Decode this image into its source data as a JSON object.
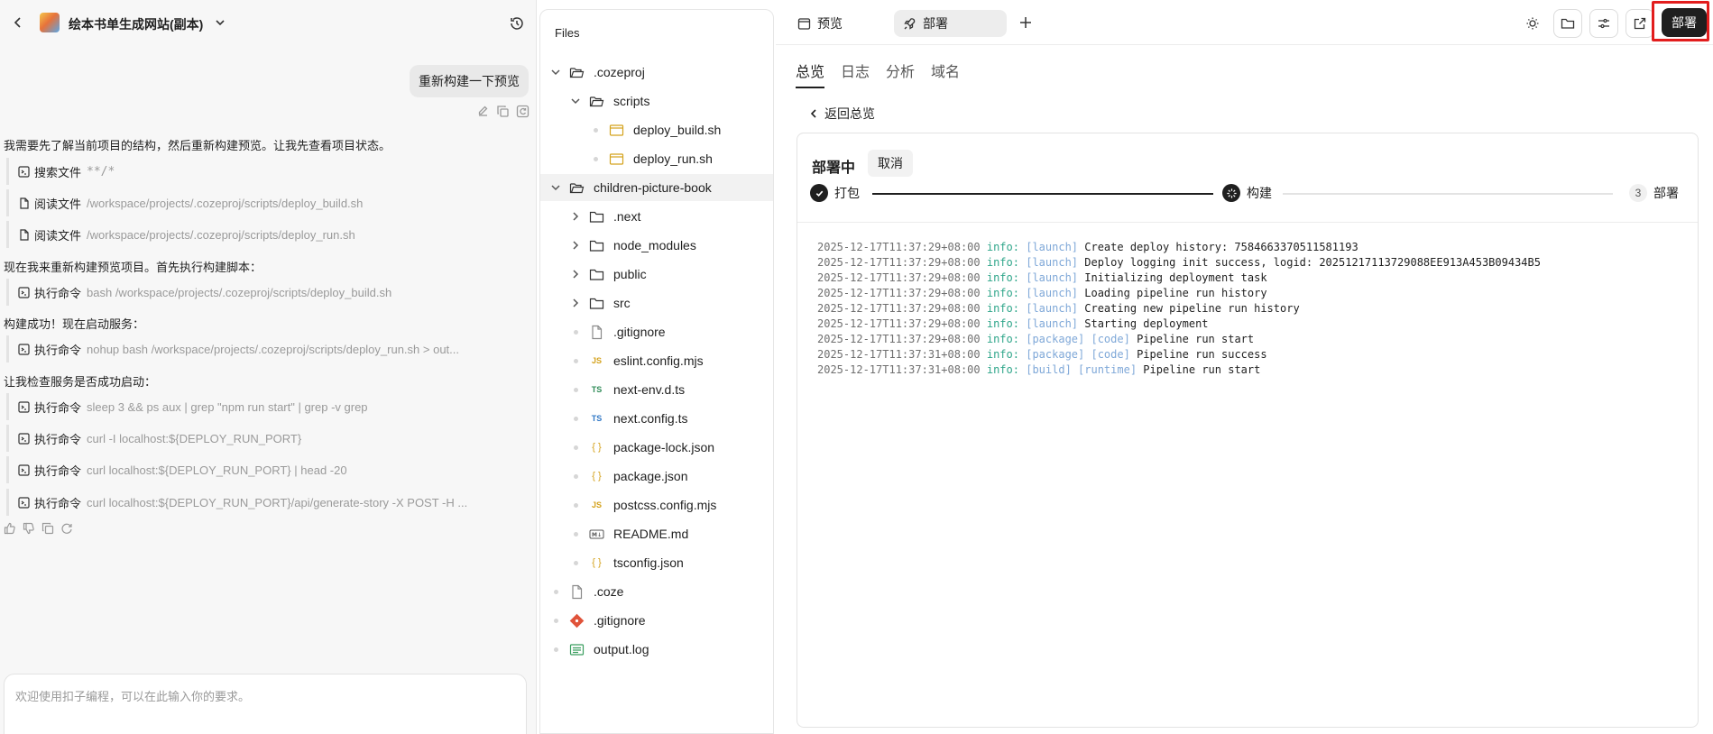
{
  "chat": {
    "project_title": "绘本书单生成网站(副本)",
    "user_message": "重新构建一下预览",
    "messages": [
      {
        "type": "text",
        "text": "我需要先了解当前项目的结构，然后重新构建预览。让我先查看项目状态。"
      },
      {
        "type": "tool",
        "icon": "search-icon",
        "label": "搜索文件",
        "value": "**/*"
      },
      {
        "type": "tool",
        "icon": "file-icon",
        "label": "阅读文件",
        "value": "/workspace/projects/.cozeproj/scripts/deploy_build.sh"
      },
      {
        "type": "tool",
        "icon": "file-icon",
        "label": "阅读文件",
        "value": "/workspace/projects/.cozeproj/scripts/deploy_run.sh"
      },
      {
        "type": "text",
        "text": "现在我来重新构建预览项目。首先执行构建脚本："
      },
      {
        "type": "tool",
        "icon": "terminal-icon",
        "label": "执行命令",
        "value": "bash /workspace/projects/.cozeproj/scripts/deploy_build.sh"
      },
      {
        "type": "text",
        "text": "构建成功！现在启动服务："
      },
      {
        "type": "tool",
        "icon": "terminal-icon",
        "label": "执行命令",
        "value": "nohup bash /workspace/projects/.cozeproj/scripts/deploy_run.sh > out..."
      },
      {
        "type": "text",
        "text": "让我检查服务是否成功启动："
      },
      {
        "type": "tool",
        "icon": "terminal-icon",
        "label": "执行命令",
        "value": "sleep 3 && ps aux | grep \"npm run start\" | grep -v grep"
      },
      {
        "type": "tool",
        "icon": "terminal-icon",
        "label": "执行命令",
        "value": "curl -I localhost:${DEPLOY_RUN_PORT}"
      },
      {
        "type": "tool",
        "icon": "terminal-icon",
        "label": "执行命令",
        "value": "curl localhost:${DEPLOY_RUN_PORT} | head -20"
      },
      {
        "type": "tool",
        "icon": "terminal-icon",
        "label": "执行命令",
        "value": "curl localhost:${DEPLOY_RUN_PORT}/api/generate-story -X POST -H ..."
      }
    ],
    "input_placeholder": "欢迎使用扣子编程，可以在此输入你的要求。"
  },
  "files": {
    "title": "Files",
    "tree": [
      {
        "name": ".cozeproj",
        "kind": "folder-open",
        "depth": 0
      },
      {
        "name": "scripts",
        "kind": "folder-open",
        "depth": 1
      },
      {
        "name": "deploy_build.sh",
        "kind": "sh",
        "depth": 2
      },
      {
        "name": "deploy_run.sh",
        "kind": "sh",
        "depth": 2
      },
      {
        "name": "children-picture-book",
        "kind": "folder-open",
        "depth": 0,
        "selected": true
      },
      {
        "name": ".next",
        "kind": "folder",
        "depth": 1
      },
      {
        "name": "node_modules",
        "kind": "folder",
        "depth": 1
      },
      {
        "name": "public",
        "kind": "folder",
        "depth": 1
      },
      {
        "name": "src",
        "kind": "folder",
        "depth": 1
      },
      {
        "name": ".gitignore",
        "kind": "file",
        "depth": 1
      },
      {
        "name": "eslint.config.mjs",
        "kind": "js",
        "depth": 1
      },
      {
        "name": "next-env.d.ts",
        "kind": "ts-green",
        "depth": 1
      },
      {
        "name": "next.config.ts",
        "kind": "ts",
        "depth": 1
      },
      {
        "name": "package-lock.json",
        "kind": "json",
        "depth": 1
      },
      {
        "name": "package.json",
        "kind": "json",
        "depth": 1
      },
      {
        "name": "postcss.config.mjs",
        "kind": "js",
        "depth": 1
      },
      {
        "name": "README.md",
        "kind": "md",
        "depth": 1
      },
      {
        "name": "tsconfig.json",
        "kind": "json",
        "depth": 1
      },
      {
        "name": ".coze",
        "kind": "file",
        "depth": 0
      },
      {
        "name": ".gitignore",
        "kind": "git",
        "depth": 0
      },
      {
        "name": "output.log",
        "kind": "log",
        "depth": 0
      }
    ]
  },
  "right": {
    "tabs": [
      {
        "label": "预览",
        "icon": "preview-icon",
        "active": false
      },
      {
        "label": "部署",
        "icon": "rocket-icon",
        "active": true
      }
    ],
    "deploy_button": "部署",
    "subtabs": [
      "总览",
      "日志",
      "分析",
      "域名"
    ],
    "back_label": "返回总览",
    "status": "部署中",
    "cancel_label": "取消",
    "steps": [
      {
        "label": "打包",
        "state": "done"
      },
      {
        "label": "构建",
        "state": "active"
      },
      {
        "label": "部署",
        "state": "pending",
        "number": "3"
      }
    ],
    "log": [
      {
        "ts": "2025-12-17T11:37:29+08:00",
        "level": "info:",
        "tags": [
          "[launch]"
        ],
        "msg": "Create deploy history: 7584663370511581193"
      },
      {
        "ts": "2025-12-17T11:37:29+08:00",
        "level": "info:",
        "tags": [
          "[launch]"
        ],
        "msg": "Deploy logging init success, logid: 20251217113729088EE913A453B09434B5"
      },
      {
        "ts": "2025-12-17T11:37:29+08:00",
        "level": "info:",
        "tags": [
          "[launch]"
        ],
        "msg": "Initializing deployment task"
      },
      {
        "ts": "2025-12-17T11:37:29+08:00",
        "level": "info:",
        "tags": [
          "[launch]"
        ],
        "msg": "Loading pipeline run history"
      },
      {
        "ts": "2025-12-17T11:37:29+08:00",
        "level": "info:",
        "tags": [
          "[launch]"
        ],
        "msg": "Creating new pipeline run history"
      },
      {
        "ts": "2025-12-17T11:37:29+08:00",
        "level": "info:",
        "tags": [
          "[launch]"
        ],
        "msg": "Starting deployment"
      },
      {
        "ts": "2025-12-17T11:37:29+08:00",
        "level": "info:",
        "tags": [
          "[package]",
          "[code]"
        ],
        "msg": "Pipeline run start"
      },
      {
        "ts": "2025-12-17T11:37:31+08:00",
        "level": "info:",
        "tags": [
          "[package]",
          "[code]"
        ],
        "msg": "Pipeline run success"
      },
      {
        "ts": "2025-12-17T11:37:31+08:00",
        "level": "info:",
        "tags": [
          "[build]",
          "[runtime]"
        ],
        "msg": "Pipeline run start"
      }
    ]
  },
  "colors": {
    "accent_dark": "#1f1f1f",
    "log_level": "#2fa68a",
    "log_tag": "#7fa8d8",
    "highlight": "#e21d1d"
  }
}
